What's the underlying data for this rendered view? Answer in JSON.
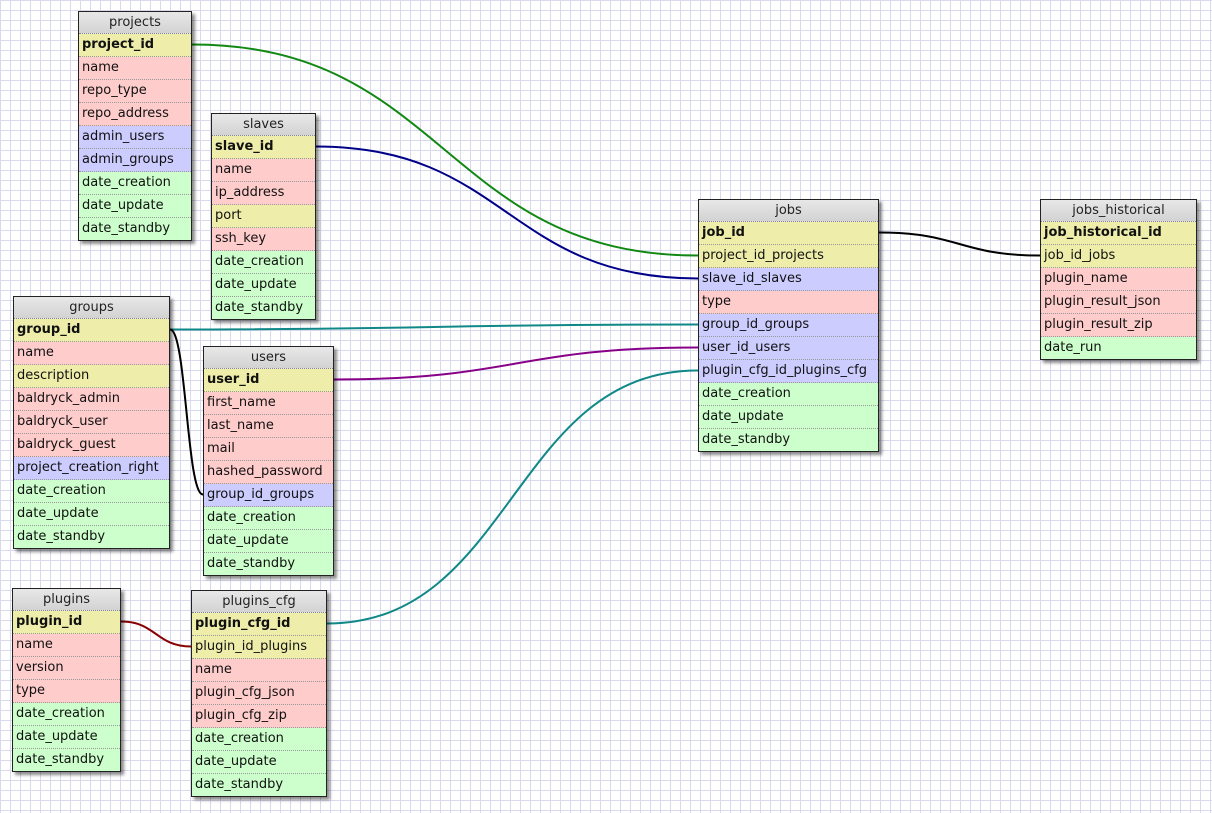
{
  "tables": [
    {
      "id": "projects",
      "name": "projects",
      "fields": [
        {
          "name": "project_id",
          "color": "yellow",
          "pk": true
        },
        {
          "name": "name",
          "color": "pink"
        },
        {
          "name": "repo_type",
          "color": "pink"
        },
        {
          "name": "repo_address",
          "color": "pink"
        },
        {
          "name": "admin_users",
          "color": "blue"
        },
        {
          "name": "admin_groups",
          "color": "blue"
        },
        {
          "name": "date_creation",
          "color": "green"
        },
        {
          "name": "date_update",
          "color": "green"
        },
        {
          "name": "date_standby",
          "color": "green"
        }
      ]
    },
    {
      "id": "slaves",
      "name": "slaves",
      "fields": [
        {
          "name": "slave_id",
          "color": "yellow",
          "pk": true
        },
        {
          "name": "name",
          "color": "pink"
        },
        {
          "name": "ip_address",
          "color": "pink"
        },
        {
          "name": "port",
          "color": "yellow"
        },
        {
          "name": "ssh_key",
          "color": "pink"
        },
        {
          "name": "date_creation",
          "color": "green"
        },
        {
          "name": "date_update",
          "color": "green"
        },
        {
          "name": "date_standby",
          "color": "green"
        }
      ]
    },
    {
      "id": "groups",
      "name": "groups",
      "fields": [
        {
          "name": "group_id",
          "color": "yellow",
          "pk": true
        },
        {
          "name": "name",
          "color": "pink"
        },
        {
          "name": "description",
          "color": "yellow"
        },
        {
          "name": "baldryck_admin",
          "color": "pink"
        },
        {
          "name": "baldryck_user",
          "color": "pink"
        },
        {
          "name": "baldryck_guest",
          "color": "pink"
        },
        {
          "name": "project_creation_right",
          "color": "blue"
        },
        {
          "name": "date_creation",
          "color": "green"
        },
        {
          "name": "date_update",
          "color": "green"
        },
        {
          "name": "date_standby",
          "color": "green"
        }
      ]
    },
    {
      "id": "users",
      "name": "users",
      "fields": [
        {
          "name": "user_id",
          "color": "yellow",
          "pk": true
        },
        {
          "name": "first_name",
          "color": "pink"
        },
        {
          "name": "last_name",
          "color": "pink"
        },
        {
          "name": "mail",
          "color": "pink"
        },
        {
          "name": "hashed_password",
          "color": "pink"
        },
        {
          "name": "group_id_groups",
          "color": "blue"
        },
        {
          "name": "date_creation",
          "color": "green"
        },
        {
          "name": "date_update",
          "color": "green"
        },
        {
          "name": "date_standby",
          "color": "green"
        }
      ]
    },
    {
      "id": "plugins",
      "name": "plugins",
      "fields": [
        {
          "name": "plugin_id",
          "color": "yellow",
          "pk": true
        },
        {
          "name": "name",
          "color": "pink"
        },
        {
          "name": "version",
          "color": "pink"
        },
        {
          "name": "type",
          "color": "pink"
        },
        {
          "name": "date_creation",
          "color": "green"
        },
        {
          "name": "date_update",
          "color": "green"
        },
        {
          "name": "date_standby",
          "color": "green"
        }
      ]
    },
    {
      "id": "plugins_cfg",
      "name": "plugins_cfg",
      "fields": [
        {
          "name": "plugin_cfg_id",
          "color": "yellow",
          "pk": true
        },
        {
          "name": "plugin_id_plugins",
          "color": "yellow"
        },
        {
          "name": "name",
          "color": "pink"
        },
        {
          "name": "plugin_cfg_json",
          "color": "pink"
        },
        {
          "name": "plugin_cfg_zip",
          "color": "pink"
        },
        {
          "name": "date_creation",
          "color": "green"
        },
        {
          "name": "date_update",
          "color": "green"
        },
        {
          "name": "date_standby",
          "color": "green"
        }
      ]
    },
    {
      "id": "jobs",
      "name": "jobs",
      "fields": [
        {
          "name": "job_id",
          "color": "yellow",
          "pk": true
        },
        {
          "name": "project_id_projects",
          "color": "yellow"
        },
        {
          "name": "slave_id_slaves",
          "color": "blue"
        },
        {
          "name": "type",
          "color": "pink"
        },
        {
          "name": "group_id_groups",
          "color": "blue"
        },
        {
          "name": "user_id_users",
          "color": "blue"
        },
        {
          "name": "plugin_cfg_id_plugins_cfg",
          "color": "blue"
        },
        {
          "name": "date_creation",
          "color": "green"
        },
        {
          "name": "date_update",
          "color": "green"
        },
        {
          "name": "date_standby",
          "color": "green"
        }
      ]
    },
    {
      "id": "jobs_historical",
      "name": "jobs_historical",
      "fields": [
        {
          "name": "job_historical_id",
          "color": "yellow",
          "pk": true
        },
        {
          "name": "job_id_jobs",
          "color": "yellow"
        },
        {
          "name": "plugin_name",
          "color": "pink"
        },
        {
          "name": "plugin_result_json",
          "color": "pink"
        },
        {
          "name": "plugin_result_zip",
          "color": "pink"
        },
        {
          "name": "date_run",
          "color": "green"
        }
      ]
    }
  ],
  "relations": [
    {
      "from": "projects.project_id",
      "to": "jobs.project_id_projects",
      "color": "#118811"
    },
    {
      "from": "slaves.slave_id",
      "to": "jobs.slave_id_slaves",
      "color": "#000088"
    },
    {
      "from": "groups.group_id",
      "to": "jobs.group_id_groups",
      "color": "#118888"
    },
    {
      "from": "groups.group_id",
      "to": "users.group_id_groups",
      "color": "#000000"
    },
    {
      "from": "users.user_id",
      "to": "jobs.user_id_users",
      "color": "#880088"
    },
    {
      "from": "plugins_cfg.plugin_cfg_id",
      "to": "jobs.plugin_cfg_id_plugins_cfg",
      "color": "#118888"
    },
    {
      "from": "plugins.plugin_id",
      "to": "plugins_cfg.plugin_id_plugins",
      "color": "#880000"
    },
    {
      "from": "jobs.job_id",
      "to": "jobs_historical.job_id_jobs",
      "color": "#000000"
    }
  ]
}
